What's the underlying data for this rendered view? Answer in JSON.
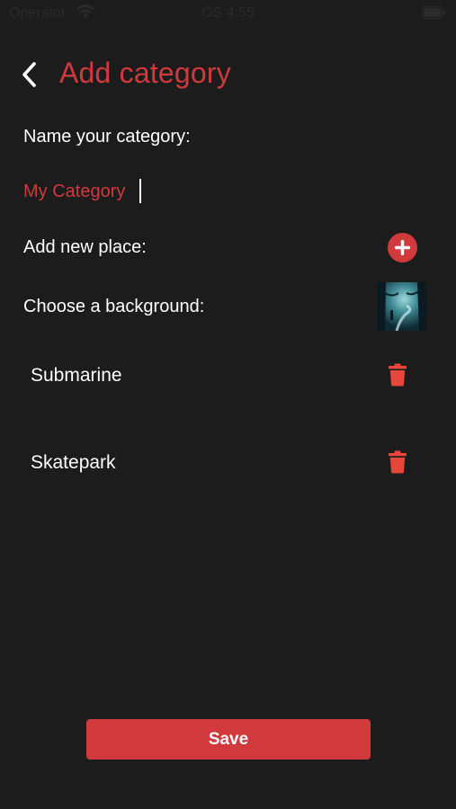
{
  "status_bar": {
    "carrier": "Operator",
    "time": "ÖS 4:55",
    "wifi_icon": "wifi-icon",
    "battery_icon": "battery-icon"
  },
  "header": {
    "back_icon": "chevron-left-icon",
    "title": "Add category"
  },
  "form": {
    "name_label": "Name your category:",
    "name_value": "My Category",
    "add_place_label": "Add new place:",
    "add_icon": "plus-circle-icon",
    "background_label": "Choose a background:",
    "background_thumbnail": "forest-path-image"
  },
  "places": [
    {
      "name": "Submarine",
      "delete_icon": "trash-icon"
    },
    {
      "name": "Skatepark",
      "delete_icon": "trash-icon"
    }
  ],
  "save_label": "Save",
  "colors": {
    "background": "#1c1c1c",
    "accent": "#d13a3d",
    "text": "#ffffff",
    "delete_icon": "#e8463a"
  }
}
